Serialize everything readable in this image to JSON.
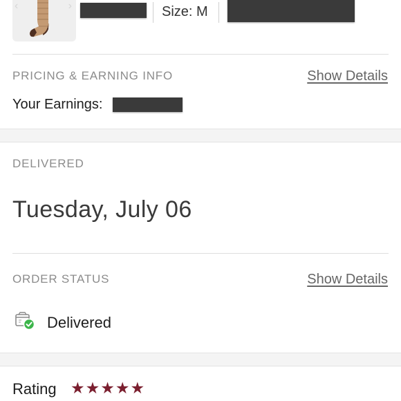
{
  "item": {
    "size_text": "Size: M",
    "image_icon": "sock-icon",
    "nav_prev": "‹",
    "nav_next": "›"
  },
  "pricing": {
    "section_title": "PRICING & EARNING INFO",
    "details_link": "Show Details",
    "earnings_label": "Your Earnings:"
  },
  "delivery": {
    "section_title": "DELIVERED",
    "date": "Tuesday, July 06"
  },
  "order_status": {
    "section_title": "ORDER STATUS",
    "details_link": "Show Details",
    "status": "Delivered",
    "status_icon": "package-check-icon"
  },
  "rating": {
    "label": "Rating",
    "stars": 5,
    "star_glyph": "★"
  },
  "colors": {
    "star": "#7b1f2f",
    "check": "#3cb54a",
    "redaction": "#3a3a3a"
  }
}
